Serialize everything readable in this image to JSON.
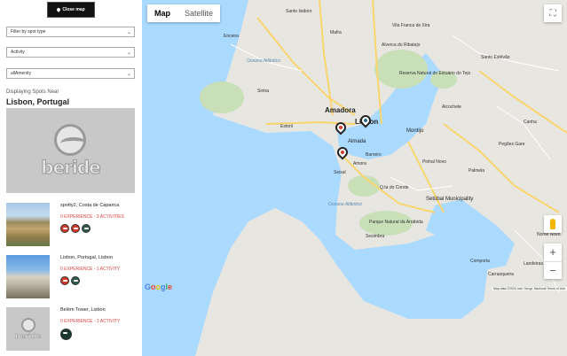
{
  "sidebar": {
    "close_map_label": "Close map",
    "filters": {
      "spot_type": "Filter by spot type",
      "activity": "Activity",
      "amenity": "allAmenity"
    },
    "displaying_label": "Displaying Spots Near",
    "location_title": "Lisbon, Portugal",
    "brand_logo_text": "beride",
    "spots": [
      {
        "name": "spotty2, Costa de Caparica",
        "meta": "0 EXPERIENCE - 3 ACTIVITIES",
        "icons": [
          "kite-icon",
          "surf-icon",
          "boat-icon"
        ]
      },
      {
        "name": "Lisbon, Portugal, Lisbon",
        "meta": "0 EXPERIENCE - 1 ACTIVITY",
        "icons": [
          "kite-icon",
          "surf-icon"
        ]
      },
      {
        "name": "Belém Tower, Lisbon",
        "meta": "0 EXPERIENCE - 1 ACTIVITY",
        "icons": [
          "boat-icon"
        ]
      }
    ]
  },
  "map": {
    "tabs": {
      "map": "Map",
      "satellite": "Satellite"
    },
    "active_tab": "Map",
    "labels": {
      "lisbon": "Lisbon",
      "amadora": "Amadora",
      "almada": "Almada",
      "montijo": "Montijo",
      "setubal": "Setúbal Municipality",
      "ocean1": "Oceano Atlântico",
      "ocean2": "Oceano Atlântico",
      "park": "Parque Natural da Arrábida",
      "reserve": "Reserva Natural do Estuário do Tejo",
      "santo_isidoro": "Santo Isidoro",
      "torres": "Mafra",
      "ericeira": "Ericeira",
      "sintra": "Sintra",
      "cascais": "Estoril",
      "barreiro": "Barreiro",
      "amora": "Amora",
      "seixal": "Seixal",
      "sesimbra": "Sesimbra",
      "palmela": "Palmela",
      "pinhal_novo": "Pinhal Novo",
      "pegoes": "Pegões Gare",
      "canha": "Canha",
      "alcochete": "Alcochete",
      "qta_conde": "Q.ta do Conde",
      "landeiras": "Landeiras",
      "vila_franca": "Vila Franca de Xira",
      "alverca": "Alverca do Ribatejo",
      "santo_estevao": "Santo Estêvão",
      "comporta": "Comporta",
      "carrasqueira": "Carrasqueira",
      "nm": "Nome Novo"
    },
    "google_letters": [
      "G",
      "o",
      "o",
      "g",
      "l",
      "e"
    ],
    "attribution": "Map data ©2020 Inst. Geogr. Nacional   Terms of Use",
    "zoom_in": "+",
    "zoom_out": "−",
    "colors": {
      "water": "#aadaff",
      "land": "#e8e6e0",
      "green": "#c8dfb8",
      "road_major": "#f9d56e",
      "road_minor": "#ffffff"
    }
  }
}
